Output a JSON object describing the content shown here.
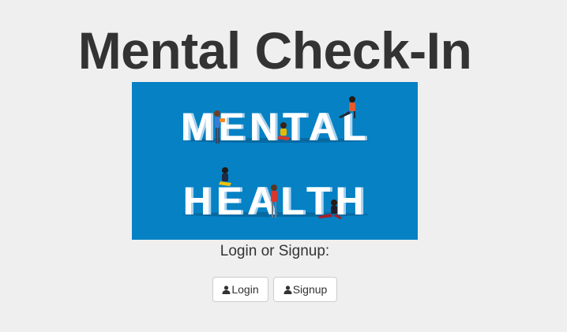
{
  "page": {
    "title": "Mental Check-In",
    "subtitle": "Login or Signup:"
  },
  "hero": {
    "line1": "MENTAL",
    "line2": "HEALTH",
    "colors": {
      "background": "#0581c4",
      "letters": "#ffffff",
      "letter_shadow": "#a9d2ee"
    }
  },
  "buttons": {
    "login_label": "Login",
    "signup_label": "Signup",
    "icon": "user-icon"
  }
}
